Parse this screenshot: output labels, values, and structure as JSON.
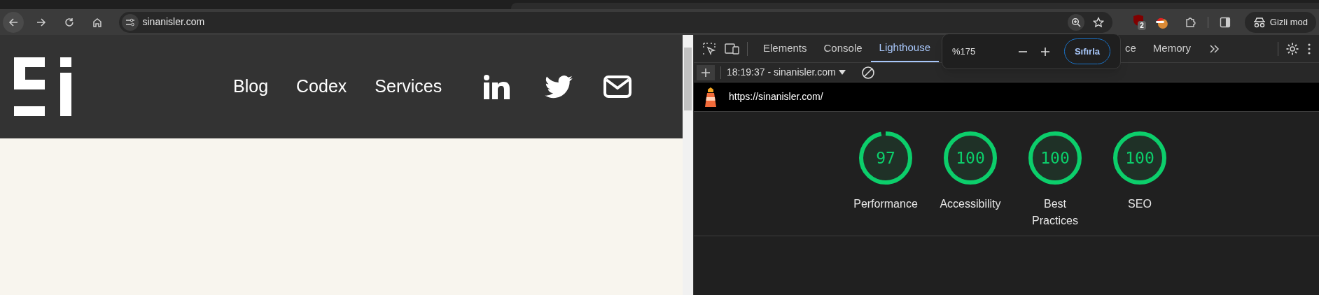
{
  "browser": {
    "address": "sinanisler.com",
    "extension_badge": "2",
    "profile_label": "Gizli mod"
  },
  "site": {
    "nav": [
      "Blog",
      "Codex",
      "Services"
    ]
  },
  "devtools": {
    "tabs": [
      {
        "label": "Elements",
        "selected": false
      },
      {
        "label": "Console",
        "selected": false
      },
      {
        "label": "Lighthouse",
        "selected": true
      },
      {
        "label": "ce",
        "selected": false
      },
      {
        "label": "Memory",
        "selected": false
      }
    ],
    "report_selector": "18:19:37 - sinanisler.com",
    "report_url": "https://sinanisler.com/",
    "zoom_popup": {
      "value": "%175",
      "reset_label": "Sıfırla"
    },
    "scores": [
      {
        "label": "Performance",
        "value": "97"
      },
      {
        "label": "Accessibility",
        "value": "100"
      },
      {
        "label": "Best Practices",
        "value": "100"
      },
      {
        "label": "SEO",
        "value": "100"
      }
    ]
  }
}
